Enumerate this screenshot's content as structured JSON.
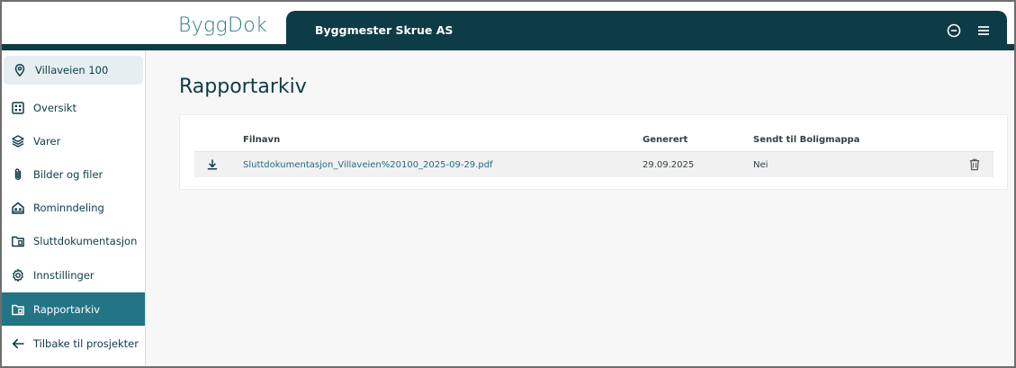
{
  "header": {
    "logo": "ByggDok",
    "org_name": "Byggmester Skrue AS",
    "icons": [
      "minus-circle-icon",
      "hamburger-menu-icon"
    ]
  },
  "sidebar": {
    "project": {
      "label": "Villaveien 100",
      "icon": "location-pin-icon"
    },
    "items": [
      {
        "label": "Oversikt",
        "icon": "dashboard-grid-icon"
      },
      {
        "label": "Varer",
        "icon": "layers-icon"
      },
      {
        "label": "Bilder og filer",
        "icon": "paperclip-icon"
      },
      {
        "label": "Rominndeling",
        "icon": "floorplan-icon"
      },
      {
        "label": "Sluttdokumentasjon",
        "icon": "folder-doc-icon"
      },
      {
        "label": "Innstillinger",
        "icon": "gear-icon"
      },
      {
        "label": "Rapportarkiv",
        "icon": "folder-archive-icon",
        "active": true
      },
      {
        "label": "Tilbake til prosjekter",
        "icon": "arrow-left-icon"
      }
    ]
  },
  "main": {
    "title": "Rapportarkiv",
    "table": {
      "columns": [
        "Filnavn",
        "Generert",
        "Sendt til Boligmappa"
      ],
      "rows": [
        {
          "filename": "Sluttdokumentasjon_Villaveien%20100_2025-09-29.pdf",
          "generated": "29.09.2025",
          "sent": "Nei"
        }
      ]
    }
  },
  "colors": {
    "brand_dark": "#0d3b46",
    "active_nav": "#237484",
    "logo": "#2b7a88",
    "link": "#1f6e7e"
  }
}
